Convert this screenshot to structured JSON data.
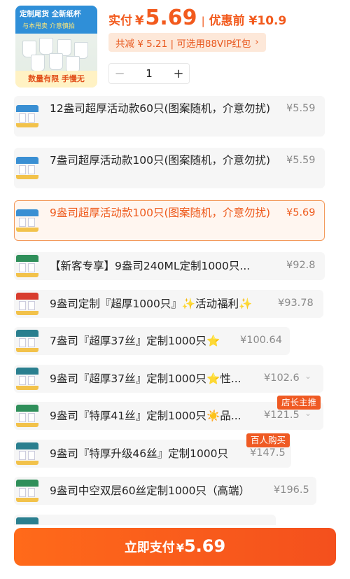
{
  "header": {
    "thumbnail": {
      "line1": "定制尾货 全新纸杯",
      "line2": "与本甩卖 介意慎拍",
      "banner": "数量有限 手慢无"
    },
    "pay_label": "实付",
    "currency": "¥",
    "pay_amount": "5.69",
    "separator": "|",
    "original_label": "优惠前 ¥10.9",
    "discount_text": "共减 ¥ 5.21 | 可选用88VIP红包",
    "discount_chevron": "›",
    "quantity": "1",
    "minus": "−",
    "plus": "+"
  },
  "skus": [
    {
      "name": "12盎司超厚活动款60只(图案随机，介意勿扰)",
      "price": "¥5.59",
      "selected": false
    },
    {
      "name": "7盎司超厚活动款100只(图案随机，介意勿扰)",
      "price": "¥5.59",
      "selected": false
    },
    {
      "name": "9盎司超厚活动款100只(图案随机，介意勿扰)",
      "price": "¥5.69",
      "selected": true
    },
    {
      "name": "【新客专享】9盎司240ML定制1000只...",
      "price": "¥92.8",
      "selected": false
    },
    {
      "name": "9盎司定制『超厚1000只』✨活动福利✨",
      "price": "¥93.78",
      "selected": false
    },
    {
      "name": "7盎司『超厚37丝』定制1000只⭐",
      "price": "¥100.64",
      "selected": false
    },
    {
      "name": "9盎司『超厚37丝』定制1000只⭐性...",
      "price": "¥102.6",
      "selected": false,
      "chevron": "⌄"
    },
    {
      "name": "9盎司『特厚41丝』定制1000只☀️品...",
      "price": "¥121.5",
      "selected": false,
      "chevron": "⌄",
      "tag": "店长主推"
    },
    {
      "name": "9盎司『特厚升级46丝』定制1000只",
      "price": "¥147.5",
      "selected": false,
      "tag": "百人购买"
    },
    {
      "name": "9盎司中空双层60丝定制1000只（高端）",
      "price": "¥196.5",
      "selected": false
    }
  ],
  "pay_button": {
    "label": "立即支付",
    "currency": "¥",
    "amount": "5.69"
  },
  "colors": {
    "accent": "#f25a1d",
    "selected_border": "#f39a5c",
    "tag_bg": "#ef5a23"
  }
}
